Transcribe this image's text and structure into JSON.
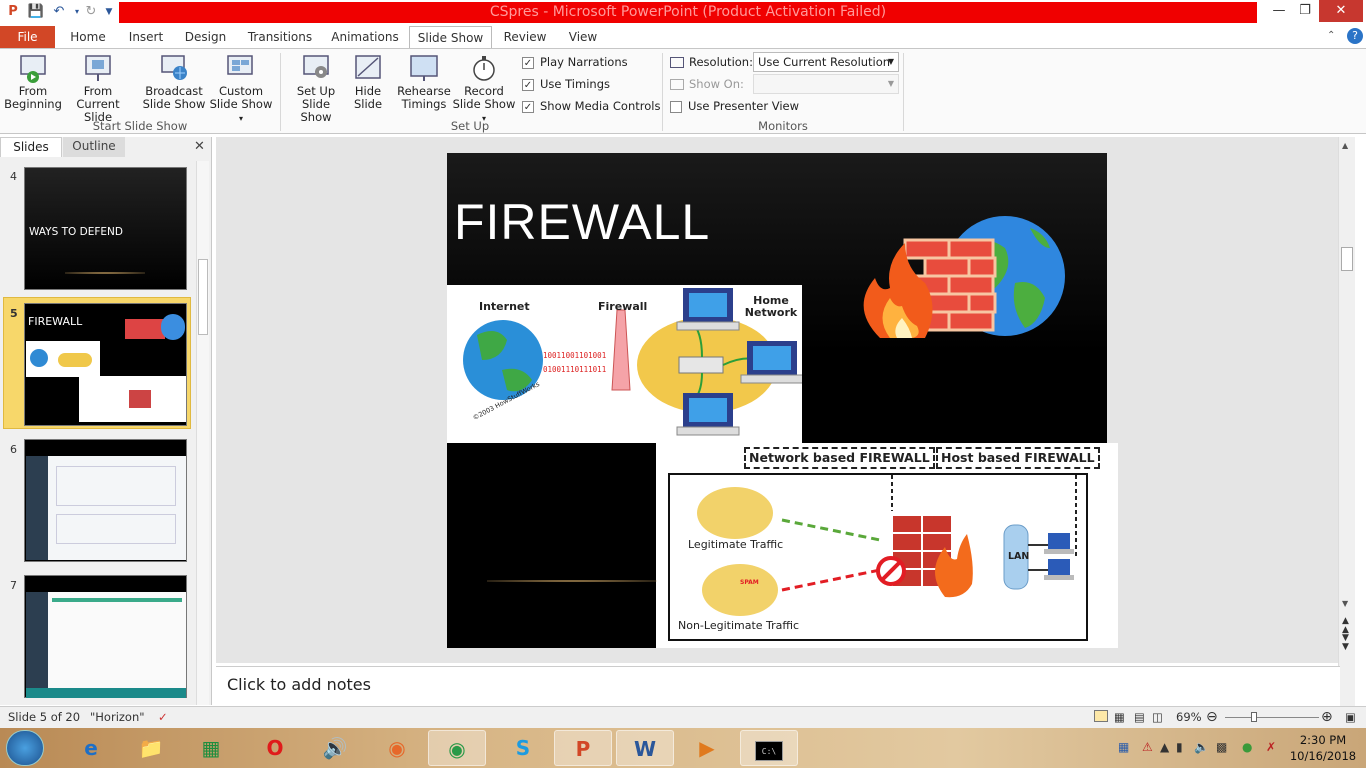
{
  "window": {
    "title": "CSpres - Microsoft PowerPoint (Product Activation Failed)"
  },
  "tabs": [
    "File",
    "Home",
    "Insert",
    "Design",
    "Transitions",
    "Animations",
    "Slide Show",
    "Review",
    "View"
  ],
  "ribbon": {
    "start": {
      "from_beginning": "From Beginning",
      "from_current": "From Current Slide",
      "broadcast": "Broadcast Slide Show",
      "custom": "Custom Slide Show",
      "group_label": "Start Slide Show"
    },
    "setup": {
      "setup_show": "Set Up Slide Show",
      "hide_slide": "Hide Slide",
      "rehearse": "Rehearse Timings",
      "record": "Record Slide Show",
      "play_narrations": "Play Narrations",
      "use_timings": "Use Timings",
      "show_media": "Show Media Controls",
      "group_label": "Set Up"
    },
    "monitors": {
      "resolution_label": "Resolution:",
      "resolution_value": "Use Current Resolution",
      "show_on_label": "Show On:",
      "presenter_view": "Use Presenter View",
      "group_label": "Monitors"
    }
  },
  "panel": {
    "tab_slides": "Slides",
    "tab_outline": "Outline",
    "thumbs": [
      {
        "num": "4",
        "text": "WAYS TO DEFEND"
      },
      {
        "num": "5",
        "text": "FIREWALL"
      },
      {
        "num": "6",
        "text": ""
      },
      {
        "num": "7",
        "text": ""
      }
    ]
  },
  "slide": {
    "title": "FIREWALL",
    "diagram1": {
      "internet": "Internet",
      "firewall": "Firewall",
      "home_network": "Home Network",
      "copyright": "©2003 HowStuffWorks",
      "binary_top": "10011001101001",
      "binary_bottom": "01001110111011"
    },
    "diagram2": {
      "network_based": "Network based FIREWALL",
      "host_based": "Host based FIREWALL",
      "legit": "Legitimate Traffic",
      "nonlegit": "Non-Legitimate Traffic",
      "lan": "LAN",
      "spam": "SPAM"
    }
  },
  "notes": {
    "placeholder": "Click to add notes"
  },
  "status": {
    "slide_info": "Slide 5 of 20",
    "theme": "\"Horizon\"",
    "zoom": "69%"
  },
  "taskbar": {
    "time": "2:30 PM",
    "date": "10/16/2018"
  },
  "colors": {
    "title_bar": "#f00000",
    "file_tab": "#d24726",
    "selected_thumb": "#f7d76a"
  }
}
